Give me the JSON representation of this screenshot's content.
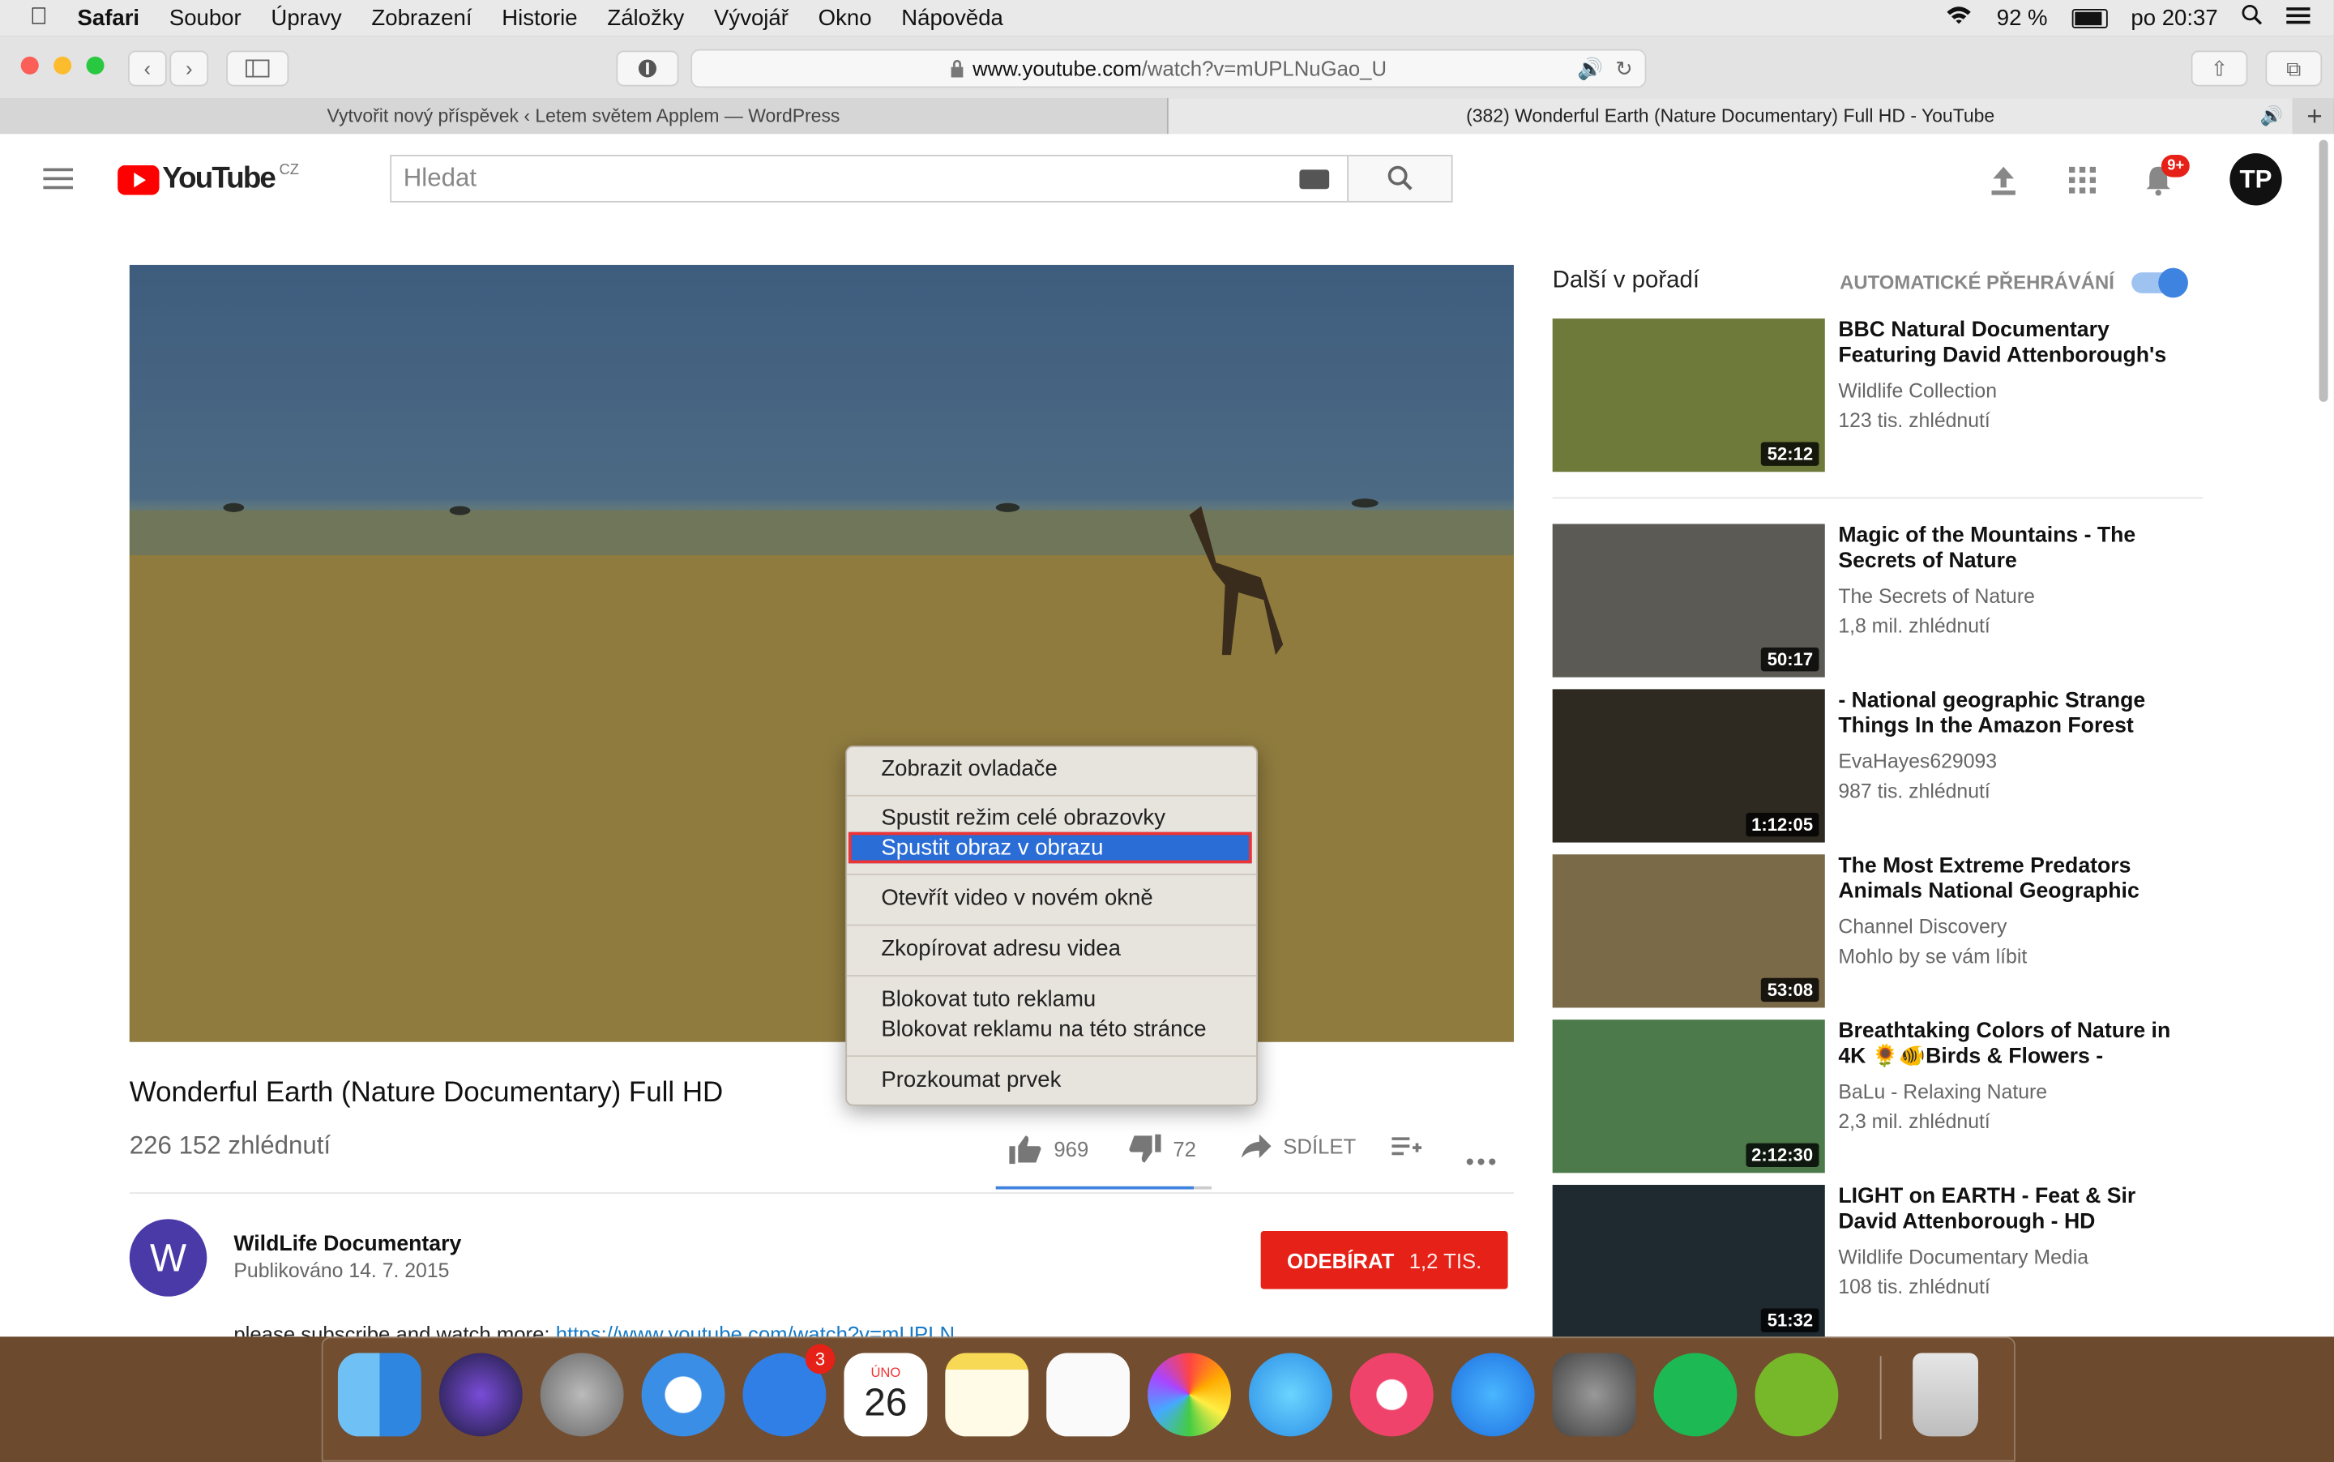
{
  "menubar": {
    "app": "Safari",
    "items": [
      "Soubor",
      "Úpravy",
      "Zobrazení",
      "Historie",
      "Záložky",
      "Vývojář",
      "Okno",
      "Nápověda"
    ],
    "battery": "92 %",
    "clock": "po 20:37"
  },
  "browser": {
    "url_domain": "www.youtube.com",
    "url_path": "/watch?v=mUPLNuGao_U",
    "tabs": [
      "Vytvořit nový příspěvek ‹ Letem světem Applem — WordPress",
      "(382) Wonderful Earth (Nature Documentary) Full HD - YouTube"
    ]
  },
  "youtube": {
    "logo_text": "YouTube",
    "region": "CZ",
    "search_placeholder": "Hledat",
    "notif_count": "9+",
    "avatar_text": "TP"
  },
  "context_menu": [
    "Zobrazit ovladače",
    "Spustit režim celé obrazovky",
    "Spustit obraz v obrazu",
    "Otevřít video v novém okně",
    "Zkopírovat adresu videa",
    "Blokovat tuto reklamu",
    "Blokovat reklamu na této stránce",
    "Prozkoumat prvek"
  ],
  "video": {
    "title": "Wonderful Earth (Nature Documentary) Full HD",
    "views": "226 152 zhlédnutí",
    "likes": "969",
    "dislikes": "72",
    "share": "SDÍLET",
    "channel_initial": "W",
    "channel": "WildLife Documentary",
    "published": "Publikováno 14. 7. 2015",
    "subscribe": "ODEBÍRAT",
    "subscribers": "1,2 TIS.",
    "description": "please subscribe and watch more: ",
    "description_link": "https://www.youtube.com/watch?v=mUPLN"
  },
  "upnext": {
    "heading": "Další v pořadí",
    "autoplay": "AUTOMATICKÉ PŘEHRÁVÁNÍ",
    "items": [
      {
        "title": "BBC Natural Documentary Featuring David Attenborough's",
        "channel": "Wildlife Collection",
        "meta": "123 tis. zhlédnutí",
        "duration": "52:12",
        "color": "#6d7a3a"
      },
      {
        "title": "Magic of the Mountains - The Secrets of Nature",
        "channel": "The Secrets of Nature",
        "meta": "1,8 mil. zhlédnutí",
        "duration": "50:17",
        "color": "#5b5a55"
      },
      {
        "title": "- National geographic Strange Things In the Amazon Forest",
        "channel": "EvaHayes629093",
        "meta": "987 tis. zhlédnutí",
        "duration": "1:12:05",
        "color": "#2e2a22"
      },
      {
        "title": "The Most Extreme Predators Animals National Geographic",
        "channel": "Channel Discovery",
        "meta": "Mohlo by se vám líbit",
        "duration": "53:08",
        "color": "#7a6a48"
      },
      {
        "title": "Breathtaking Colors of Nature in 4K 🌻🐠Birds & Flowers -",
        "channel": "BaLu - Relaxing Nature",
        "meta": "2,3 mil. zhlédnutí",
        "duration": "2:12:30",
        "color": "#4d7a4a"
      },
      {
        "title": "LIGHT on EARTH - Feat & Sir David Attenborough - HD",
        "channel": "Wildlife Documentary Media",
        "meta": "108 tis. zhlédnutí",
        "duration": "51:32",
        "color": "#1e2a30"
      }
    ]
  },
  "dock": {
    "mail_badge": "3",
    "calendar_month": "ÚNO",
    "calendar_day": "26"
  }
}
